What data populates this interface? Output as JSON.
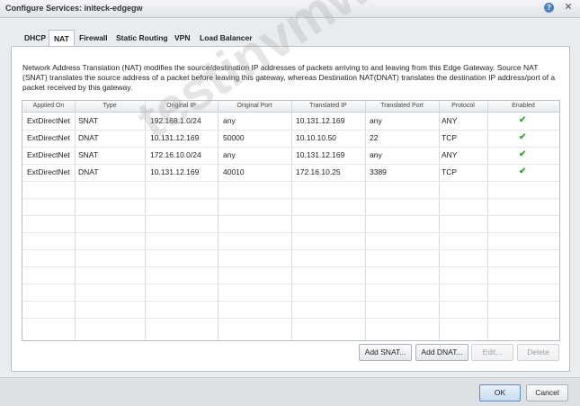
{
  "window": {
    "title": "Configure Services: initeck-edgegw",
    "help_glyph": "?",
    "close_glyph": "✕"
  },
  "tabs": [
    {
      "label": "DHCP"
    },
    {
      "label": "NAT",
      "active": true
    },
    {
      "label": "Firewall"
    },
    {
      "label": "Static Routing"
    },
    {
      "label": "VPN"
    },
    {
      "label": "Load Balancer"
    }
  ],
  "description": "Network Address Translation (NAT) modifies the source/destination IP addresses of packets arriving to and leaving from this Edge Gateway. Source NAT (SNAT) translates the source address of a packet before leaving this gateway, whereas Destination NAT(DNAT) translates the destination IP address/port of a packet received by this gateway.",
  "table": {
    "columns": [
      "Applied On",
      "Type",
      "Original IP",
      "Original Port",
      "Translated IP",
      "Translated Port",
      "Protocol",
      "Enabled"
    ],
    "rows": [
      {
        "applied_on": "ExtDirectNet",
        "type": "SNAT",
        "original_ip": "192.168.1.0/24",
        "original_port": "any",
        "translated_ip": "10.131.12.169",
        "translated_port": "any",
        "protocol": "ANY",
        "enabled": "✔"
      },
      {
        "applied_on": "ExtDirectNet",
        "type": "DNAT",
        "original_ip": "10.131.12.169",
        "original_port": "50000",
        "translated_ip": "10.10.10.50",
        "translated_port": "22",
        "protocol": "TCP",
        "enabled": "✔"
      },
      {
        "applied_on": "ExtDirectNet",
        "type": "SNAT",
        "original_ip": "172.16.10.0/24",
        "original_port": "any",
        "translated_ip": "10.131.12.169",
        "translated_port": "any",
        "protocol": "ANY",
        "enabled": "✔"
      },
      {
        "applied_on": "ExtDirectNet",
        "type": "DNAT",
        "original_ip": "10.131.12.169",
        "original_port": "40010",
        "translated_ip": "172.16.10.25",
        "translated_port": "3389",
        "protocol": "TCP",
        "enabled": "✔"
      }
    ]
  },
  "actions": {
    "add_snat": "Add SNAT...",
    "add_dnat": "Add DNAT...",
    "edit": "Edit...",
    "delete": "Delete"
  },
  "footer": {
    "ok": "OK",
    "cancel": "Cancel"
  },
  "watermark": "testinvmware.com",
  "colors": {
    "accent": "#4a7fc1",
    "check": "#3aa33a"
  }
}
